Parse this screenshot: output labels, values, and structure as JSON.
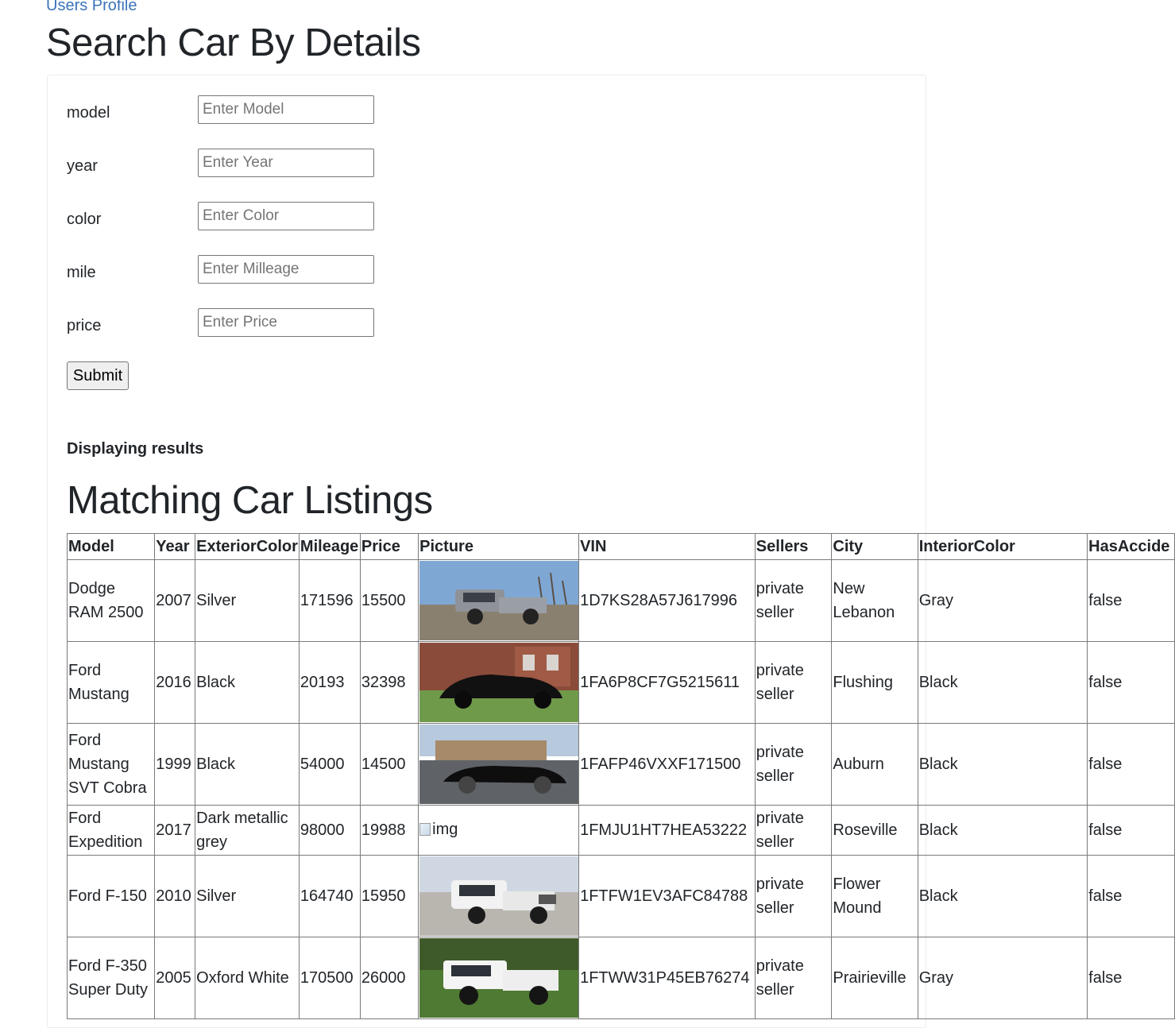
{
  "nav": {
    "users_profile_link": "Users Profile"
  },
  "page": {
    "title": "Search Car By Details"
  },
  "search_form": {
    "fields": [
      {
        "label": "model",
        "placeholder": "Enter Model",
        "value": ""
      },
      {
        "label": "year",
        "placeholder": "Enter Year",
        "value": ""
      },
      {
        "label": "color",
        "placeholder": "Enter Color",
        "value": ""
      },
      {
        "label": "mile",
        "placeholder": "Enter Milleage",
        "value": ""
      },
      {
        "label": "price",
        "placeholder": "Enter Price",
        "value": ""
      }
    ],
    "submit_label": "Submit"
  },
  "results": {
    "status_text": "Displaying results",
    "heading": "Matching Car Listings",
    "columns": [
      "Model",
      "Year",
      "ExteriorColor",
      "Mileage",
      "Price",
      "Picture",
      "VIN",
      "Sellers",
      "City",
      "InteriorColor",
      "HasAccide"
    ],
    "rows": [
      {
        "model": "Dodge RAM 2500",
        "year": "2007",
        "exterior_color": "Silver",
        "mileage": "171596",
        "price": "15500",
        "picture": "silver-pickup-truck-photo",
        "vin": "1D7KS28A57J617996",
        "seller": "private seller",
        "city": "New Lebanon",
        "interior_color": "Gray",
        "has_accident": "false"
      },
      {
        "model": "Ford Mustang",
        "year": "2016",
        "exterior_color": "Black",
        "mileage": "20193",
        "price": "32398",
        "picture": "black-sports-car-photo",
        "vin": "1FA6P8CF7G5215611",
        "seller": "private seller",
        "city": "Flushing",
        "interior_color": "Black",
        "has_accident": "false"
      },
      {
        "model": "Ford Mustang SVT Cobra",
        "year": "1999",
        "exterior_color": "Black",
        "mileage": "54000",
        "price": "14500",
        "picture": "black-convertible-photo",
        "vin": "1FAFP46VXXF171500",
        "seller": "private seller",
        "city": "Auburn",
        "interior_color": "Black",
        "has_accident": "false"
      },
      {
        "model": "Ford Expedition",
        "year": "2017",
        "exterior_color": "Dark metallic grey",
        "mileage": "98000",
        "price": "19988",
        "picture_alt": "img",
        "vin": "1FMJU1HT7HEA53222",
        "seller": "private seller",
        "city": "Roseville",
        "interior_color": "Black",
        "has_accident": "false"
      },
      {
        "model": "Ford F-150",
        "year": "2010",
        "exterior_color": "Silver",
        "mileage": "164740",
        "price": "15950",
        "picture": "white-pickup-truck-photo",
        "vin": "1FTFW1EV3AFC84788",
        "seller": "private seller",
        "city": "Flower Mound",
        "interior_color": "Black",
        "has_accident": "false"
      },
      {
        "model": "Ford F-350 Super Duty",
        "year": "2005",
        "exterior_color": "Oxford White",
        "mileage": "170500",
        "price": "26000",
        "picture": "white-heavy-duty-truck-photo",
        "vin": "1FTWW31P45EB76274",
        "seller": "private seller",
        "city": "Prairieville",
        "interior_color": "Gray",
        "has_accident": "false"
      }
    ]
  }
}
